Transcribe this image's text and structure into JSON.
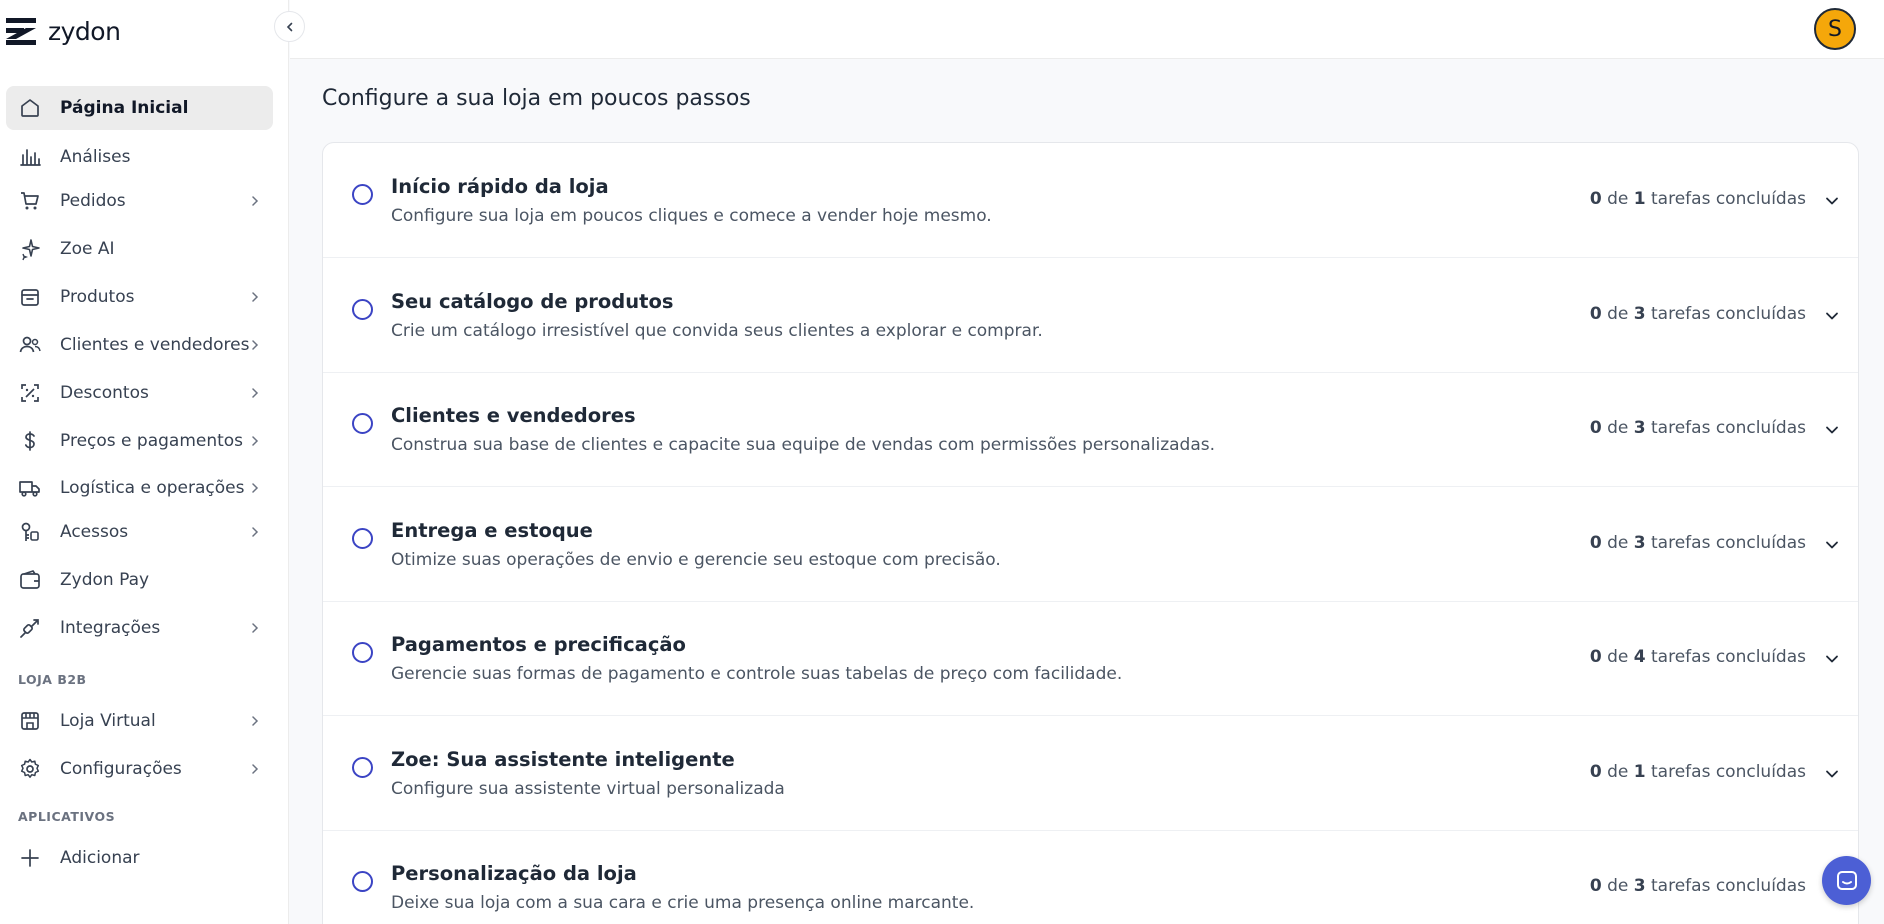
{
  "brand": {
    "name": "zydon"
  },
  "user": {
    "avatar_initial": "S"
  },
  "colors": {
    "accent": "#3b44c4",
    "avatar": "#f5a70a",
    "chat": "#4c5fd5",
    "active_bg": "#ececec"
  },
  "sidebar": {
    "items": [
      {
        "label": "Página Inicial",
        "icon": "home-icon",
        "active": true,
        "chevron": false
      },
      {
        "label": "Análises",
        "icon": "chart-bars-icon",
        "chevron": false
      },
      {
        "label": "Pedidos",
        "icon": "cart-icon",
        "chevron": true
      },
      {
        "label": "Zoe AI",
        "icon": "sparkles-icon",
        "chevron": false
      },
      {
        "label": "Produtos",
        "icon": "package-icon",
        "chevron": true
      },
      {
        "label": "Clientes e vendedores",
        "icon": "users-icon",
        "chevron": true
      },
      {
        "label": "Descontos",
        "icon": "discount-icon",
        "chevron": true
      },
      {
        "label": "Preços e pagamentos",
        "icon": "dollar-icon",
        "chevron": true
      },
      {
        "label": "Logística e operações",
        "icon": "truck-icon",
        "chevron": true
      },
      {
        "label": "Acessos",
        "icon": "key-icon",
        "chevron": true
      },
      {
        "label": "Zydon Pay",
        "icon": "wallet-icon",
        "chevron": false
      },
      {
        "label": "Integrações",
        "icon": "plug-icon",
        "chevron": true
      }
    ],
    "section_store": "LOJA B2B",
    "store_items": [
      {
        "label": "Loja Virtual",
        "icon": "storefront-icon",
        "chevron": true
      },
      {
        "label": "Configurações",
        "icon": "gear-icon",
        "chevron": true
      }
    ],
    "section_apps": "APLICATIVOS",
    "apps_items": [
      {
        "label": "Adicionar",
        "icon": "plus-icon",
        "chevron": false
      }
    ]
  },
  "main": {
    "title": "Configure a sua loja em poucos passos",
    "count_of": "de",
    "count_suffix": "tarefas concluídas",
    "steps": [
      {
        "title": "Início rápido da loja",
        "desc": "Configure sua loja em poucos cliques e comece a vender hoje mesmo.",
        "done": 0,
        "total": 1
      },
      {
        "title": "Seu catálogo de produtos",
        "desc": "Crie um catálogo irresistível que convida seus clientes a explorar e comprar.",
        "done": 0,
        "total": 3
      },
      {
        "title": "Clientes e vendedores",
        "desc": "Construa sua base de clientes e capacite sua equipe de vendas com permissões personalizadas.",
        "done": 0,
        "total": 3
      },
      {
        "title": "Entrega e estoque",
        "desc": "Otimize suas operações de envio e gerencie seu estoque com precisão.",
        "done": 0,
        "total": 3
      },
      {
        "title": "Pagamentos e precificação",
        "desc": "Gerencie suas formas de pagamento e controle suas tabelas de preço com facilidade.",
        "done": 0,
        "total": 4
      },
      {
        "title": "Zoe: Sua assistente inteligente",
        "desc": "Configure sua assistente virtual personalizada",
        "done": 0,
        "total": 1
      },
      {
        "title": "Personalização da loja",
        "desc": "Deixe sua loja com a sua cara e crie uma presença online marcante.",
        "done": 0,
        "total": 3
      }
    ]
  }
}
